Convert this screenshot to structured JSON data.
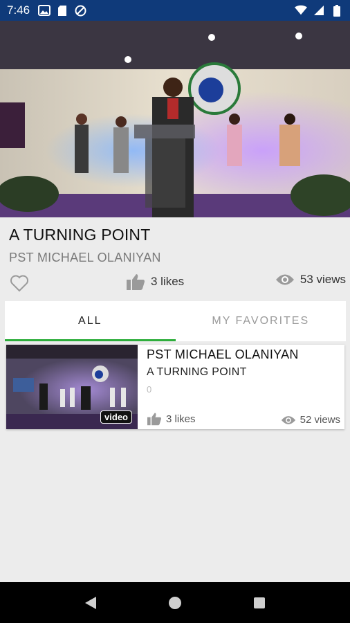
{
  "status_bar": {
    "time": "7:46",
    "left_icons": [
      "gallery-icon",
      "sd-card-icon",
      "sync-disabled-icon"
    ],
    "right_icons": [
      "wifi-icon",
      "signal-icon",
      "battery-icon"
    ],
    "background_color": "#0f3a7a"
  },
  "hero": {
    "description_icon": "sermon-video-still"
  },
  "sermon": {
    "title": "A TURNING POINT",
    "speaker": "PST MICHAEL OLANIYAN",
    "likes": "3 likes",
    "views": "53 views"
  },
  "tabs": [
    {
      "label": "ALL",
      "active": true
    },
    {
      "label": "MY FAVORITES",
      "active": false
    }
  ],
  "accent_color": "#2eae3c",
  "list": [
    {
      "speaker": "PST MICHAEL OLANIYAN",
      "title": "A TURNING POINT",
      "count": "0",
      "badge": "video",
      "likes": "3 likes",
      "views": "52 views"
    }
  ],
  "nav_bar": {
    "buttons": [
      "back-icon",
      "home-icon",
      "recents-icon"
    ]
  }
}
